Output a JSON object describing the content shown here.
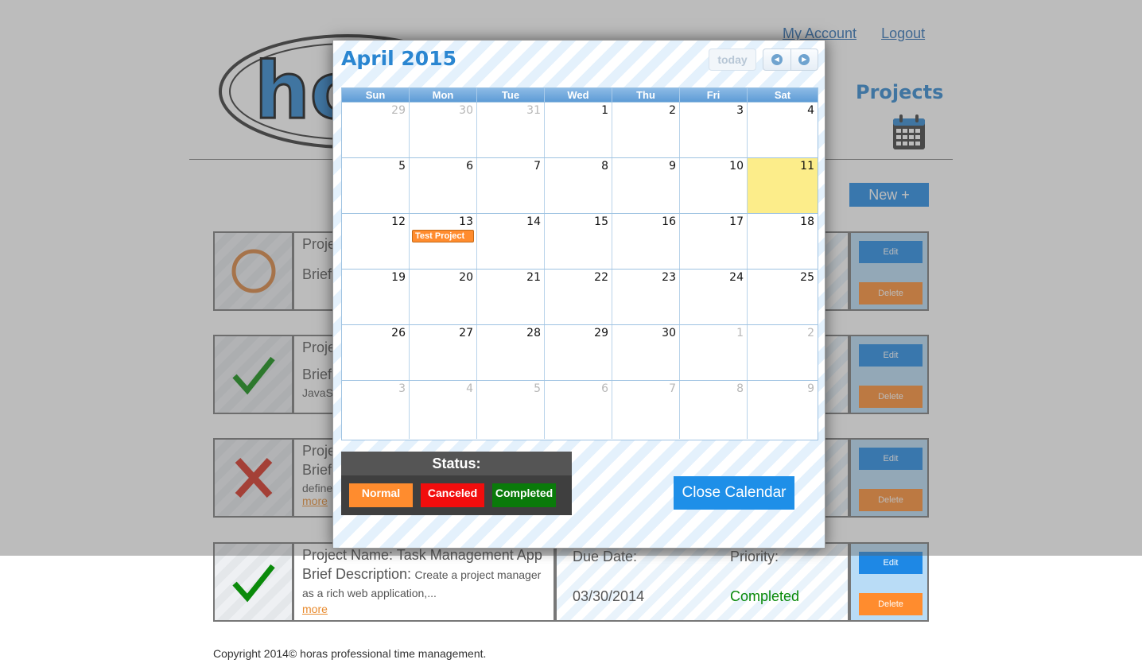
{
  "header": {
    "logo_text": "horas",
    "my_account": "My Account",
    "logout": "Logout",
    "page_title": "Projects",
    "new_button": "New +"
  },
  "projects": [
    {
      "status": "normal",
      "status_icon": "circle-icon",
      "name_label": "Proje",
      "brief_label": "Brief",
      "brief_text": "",
      "more": "",
      "due_label": "",
      "due_value": "",
      "priority_label": "",
      "priority_value": "",
      "edit": "Edit",
      "delete": "Delete"
    },
    {
      "status": "completed",
      "status_icon": "check-icon",
      "name_label": "Proje",
      "brief_label": "Brief",
      "brief_text": "JavaS",
      "more": "",
      "due_label": "",
      "due_value": "",
      "priority_label": "",
      "priority_value": "",
      "edit": "Edit",
      "delete": "Delete"
    },
    {
      "status": "canceled",
      "status_icon": "x-icon",
      "name_label": "Proje",
      "brief_label": "Brief",
      "brief_text": "define",
      "more": "more",
      "due_label": "",
      "due_value": "",
      "priority_label": "",
      "priority_value": "",
      "edit": "Edit",
      "delete": "Delete"
    },
    {
      "status": "completed",
      "status_icon": "check-icon",
      "name_label": "Project Name: Task Management App",
      "brief_label": "Brief Description:",
      "brief_text": "Create a project manager as a rich web application,...",
      "more": "more",
      "due_label": "Due Date:",
      "due_value": "03/30/2014",
      "priority_label": "Priority:",
      "priority_value": "Completed",
      "edit": "Edit",
      "delete": "Delete"
    }
  ],
  "footer": {
    "copyright": "Copyright 2014© horas professional time management."
  },
  "calendar": {
    "title": "April 2015",
    "today_button": "today",
    "prev_icon": "chevron-left-icon",
    "next_icon": "chevron-right-icon",
    "days_of_week": [
      "Sun",
      "Mon",
      "Tue",
      "Wed",
      "Thu",
      "Fri",
      "Sat"
    ],
    "weeks": [
      [
        {
          "d": "29",
          "other": true
        },
        {
          "d": "30",
          "other": true
        },
        {
          "d": "31",
          "other": true
        },
        {
          "d": "1"
        },
        {
          "d": "2"
        },
        {
          "d": "3"
        },
        {
          "d": "4"
        }
      ],
      [
        {
          "d": "5"
        },
        {
          "d": "6"
        },
        {
          "d": "7"
        },
        {
          "d": "8"
        },
        {
          "d": "9"
        },
        {
          "d": "10"
        },
        {
          "d": "11",
          "today": true
        }
      ],
      [
        {
          "d": "12"
        },
        {
          "d": "13",
          "event": "Test Project"
        },
        {
          "d": "14"
        },
        {
          "d": "15"
        },
        {
          "d": "16"
        },
        {
          "d": "17"
        },
        {
          "d": "18"
        }
      ],
      [
        {
          "d": "19"
        },
        {
          "d": "20"
        },
        {
          "d": "21"
        },
        {
          "d": "22"
        },
        {
          "d": "23"
        },
        {
          "d": "24"
        },
        {
          "d": "25"
        }
      ],
      [
        {
          "d": "26"
        },
        {
          "d": "27"
        },
        {
          "d": "28"
        },
        {
          "d": "29"
        },
        {
          "d": "30"
        },
        {
          "d": "1",
          "other": true
        },
        {
          "d": "2",
          "other": true
        }
      ],
      [
        {
          "d": "3",
          "other": true
        },
        {
          "d": "4",
          "other": true
        },
        {
          "d": "5",
          "other": true
        },
        {
          "d": "6",
          "other": true
        },
        {
          "d": "7",
          "other": true
        },
        {
          "d": "8",
          "other": true
        },
        {
          "d": "9",
          "other": true
        }
      ]
    ],
    "legend_title": "Status:",
    "legend_items": [
      {
        "label": "Normal",
        "color": "#ff8c2e"
      },
      {
        "label": "Canceled",
        "color": "#f20d0d"
      },
      {
        "label": "Completed",
        "color": "#0a7a0a"
      }
    ],
    "close_button": "Close Calendar"
  },
  "colors": {
    "accent": "#2a86d1",
    "button_blue": "#1e88e5",
    "button_orange": "#ff8c2e",
    "today_highlight": "#fced8a",
    "completed_green": "#0a8a0a",
    "canceled_red": "#d62a1a",
    "normal_orange": "#d9823b"
  }
}
